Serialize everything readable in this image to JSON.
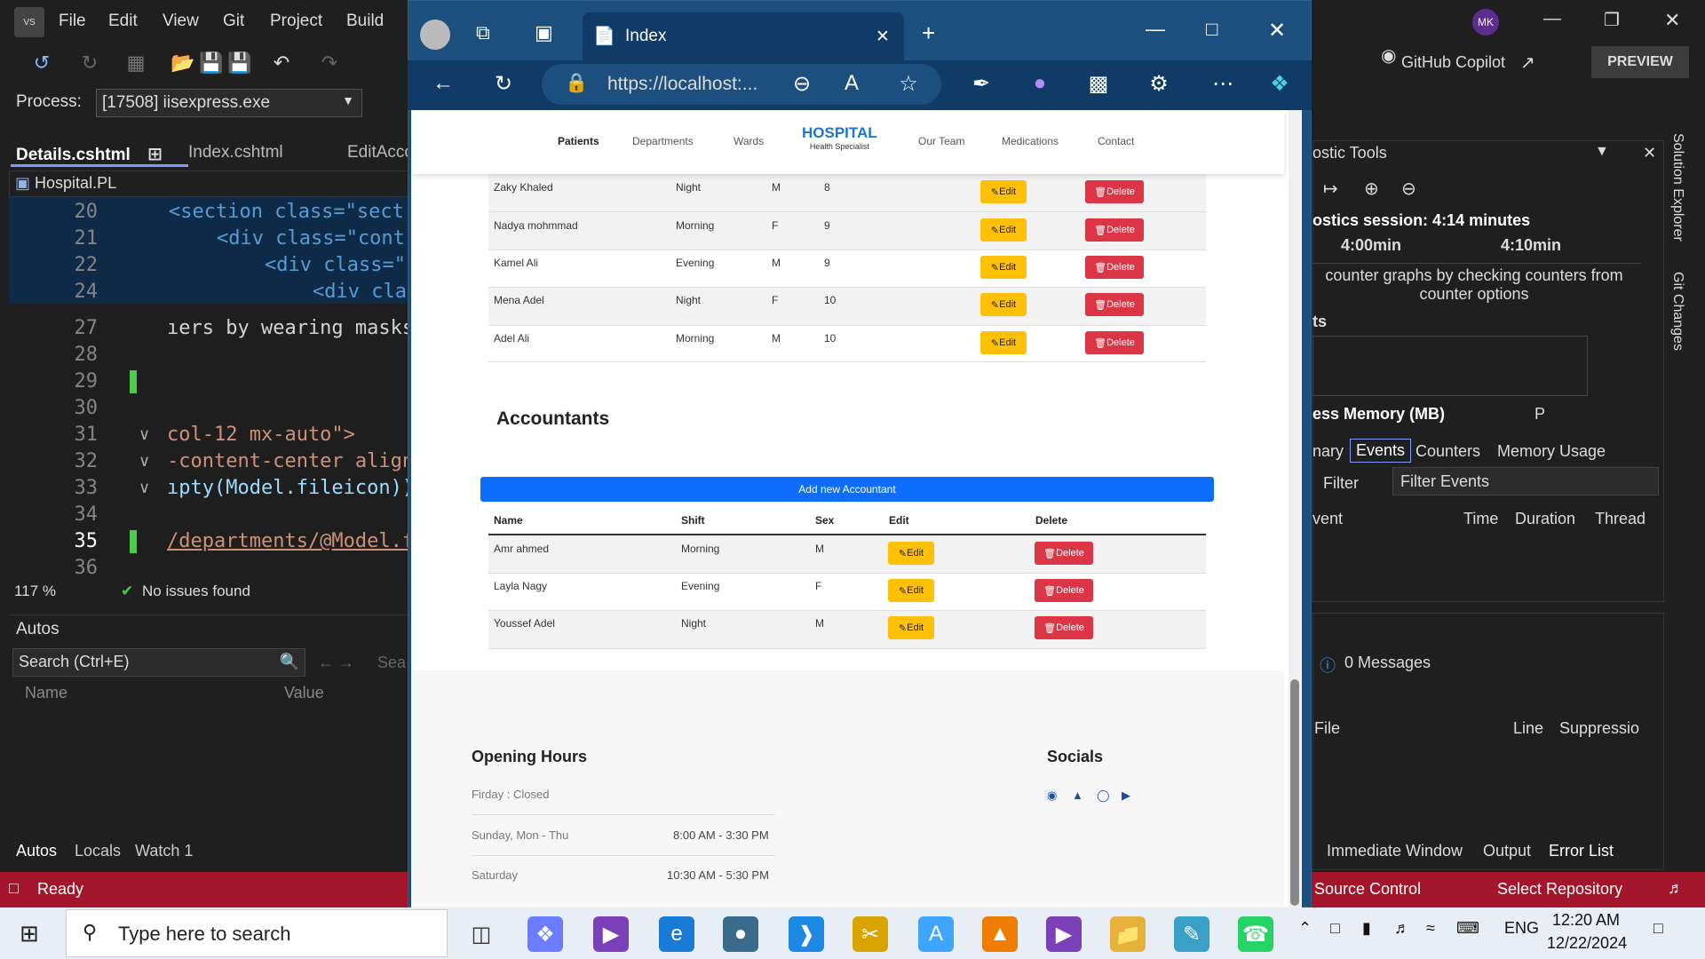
{
  "vs": {
    "menu": [
      "File",
      "Edit",
      "View",
      "Git",
      "Project",
      "Build"
    ],
    "process_label": "Process:",
    "process_value": "[17508] iisexpress.exe",
    "tabs": [
      "Details.cshtml",
      "Index.cshtml",
      "EditAcco"
    ],
    "project": "Hospital.PL",
    "lines": [
      {
        "n": "20",
        "code": "<section class=\"sect"
      },
      {
        "n": "21",
        "code": "<div class=\"cont"
      },
      {
        "n": "22",
        "code": "<div class=\""
      },
      {
        "n": "24",
        "code": "<div cla"
      },
      {
        "n": "27",
        "code": "ıers by wearing masks"
      },
      {
        "n": "28",
        "code": ""
      },
      {
        "n": "29",
        "code": ""
      },
      {
        "n": "30",
        "code": ""
      },
      {
        "n": "31",
        "code": "col-12 mx-auto\">"
      },
      {
        "n": "32",
        "code": "-content-center align"
      },
      {
        "n": "33",
        "code": "ıpty(Model.fileicon))"
      },
      {
        "n": "34",
        "code": ""
      },
      {
        "n": "35",
        "code": "/departments/@Model.f"
      },
      {
        "n": "36",
        "code": ""
      }
    ],
    "zoom": "117 %",
    "issues": "No issues found",
    "autos_title": "Autos",
    "autos_search": "Search (Ctrl+E)",
    "autos_search2": "Sea",
    "col_name": "Name",
    "col_value": "Value",
    "bottom_tabs": [
      "Autos",
      "Locals",
      "Watch 1"
    ],
    "status": "Ready",
    "source_control": "Source Control",
    "select_repo": "Select Repository",
    "copilot": "GitHub Copilot",
    "preview": "PREVIEW",
    "user_initials": "MK",
    "diag_title": "ostic Tools",
    "diag_session": "ostics session: 4:14 minutes",
    "diag_t1": "4:00min",
    "diag_t2": "4:10min",
    "diag_hint": "counter graphs by checking counters from counter options",
    "diag_events": "ts",
    "diag_memory": "ess Memory (MB)",
    "diag_p": "P",
    "diag_tabs": [
      "nary",
      "Events",
      "Counters",
      "Memory Usage"
    ],
    "filter": "Filter",
    "filter_events": "Filter Events",
    "ev_cols": [
      "vent",
      "Time",
      "Duration",
      "Thread"
    ],
    "messages": "0 Messages",
    "err_cols": [
      "File",
      "Line",
      "Suppressio"
    ],
    "bottom_right_tabs": [
      "Immediate Window",
      "Output",
      "Error List"
    ],
    "side_tabs": [
      "Solution Explorer",
      "Git Changes"
    ]
  },
  "browser": {
    "tab_title": "Index",
    "url": "https://localhost:..."
  },
  "site": {
    "nav": [
      "Patients",
      "Departments",
      "Wards",
      "Our Team",
      "Medications",
      "Contact"
    ],
    "brand": "HOSPITAL",
    "brand_sub": "Health Specialist",
    "nurses": [
      {
        "name": "Zaky Khaled",
        "shift": "Night",
        "sex": "M",
        "num": "8"
      },
      {
        "name": "Nadya mohmmad",
        "shift": "Morning",
        "sex": "F",
        "num": "9"
      },
      {
        "name": "Kamel Ali",
        "shift": "Evening",
        "sex": "M",
        "num": "9"
      },
      {
        "name": "Mena Adel",
        "shift": "Night",
        "sex": "F",
        "num": "10"
      },
      {
        "name": "Adel Ali",
        "shift": "Morning",
        "sex": "M",
        "num": "10"
      }
    ],
    "edit": "Edit",
    "delete": "Delete",
    "acc_title": "Accountants",
    "add_btn": "Add new Accountant",
    "acc_headers": [
      "Name",
      "Shift",
      "Sex",
      "Edit",
      "Delete"
    ],
    "accountants": [
      {
        "name": "Amr ahmed",
        "shift": "Morning",
        "sex": "M"
      },
      {
        "name": "Layla Nagy",
        "shift": "Evening",
        "sex": "F"
      },
      {
        "name": "Youssef Adel",
        "shift": "Night",
        "sex": "M"
      }
    ],
    "opening_title": "Opening Hours",
    "hours": [
      {
        "day": "Firday : Closed",
        "time": ""
      },
      {
        "day": "Sunday, Mon - Thu",
        "time": "8:00 AM - 3:30 PM"
      },
      {
        "day": "Saturday",
        "time": "10:30 AM - 5:30 PM"
      }
    ],
    "socials_title": "Socials"
  },
  "taskbar": {
    "search": "Type here to search",
    "lang": "ENG",
    "time": "12:20 AM",
    "date": "12/22/2024"
  }
}
